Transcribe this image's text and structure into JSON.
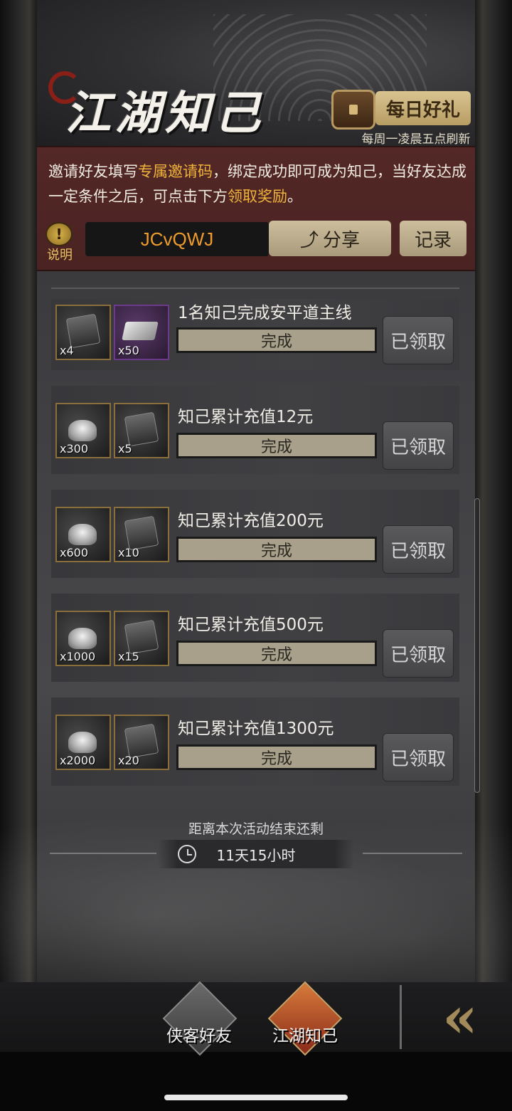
{
  "header": {
    "title": "江湖知己",
    "daily_gift_label": "每日好礼",
    "refresh_note": "每周一凌晨五点刷新"
  },
  "invite": {
    "text_part1": "邀请好友填写",
    "highlight1": "专属邀请码",
    "text_part2": "，绑定成功即可成为知己，当好友达成一定条件之后，可点击下方",
    "highlight2": "领取奖励",
    "text_part3": "。",
    "help_label": "说明",
    "invite_code": "JCvQWJ",
    "share_label": "分享",
    "record_label": "记录"
  },
  "tasks": [
    {
      "title": "1名知己完成安平道主线",
      "status": "完成",
      "button": "已领取",
      "rewards": [
        {
          "icon": "token-icon",
          "qty": "x4"
        },
        {
          "icon": "silver-bar-icon",
          "qty": "x50"
        }
      ]
    },
    {
      "title": "知己累计充值12元",
      "status": "完成",
      "button": "已领取",
      "rewards": [
        {
          "icon": "silver-ingot-icon",
          "qty": "x300"
        },
        {
          "icon": "token-icon",
          "qty": "x5"
        }
      ]
    },
    {
      "title": "知己累计充值200元",
      "status": "完成",
      "button": "已领取",
      "rewards": [
        {
          "icon": "silver-ingot-icon",
          "qty": "x600"
        },
        {
          "icon": "token-icon",
          "qty": "x10"
        }
      ]
    },
    {
      "title": "知己累计充值500元",
      "status": "完成",
      "button": "已领取",
      "rewards": [
        {
          "icon": "silver-ingot-icon",
          "qty": "x1000"
        },
        {
          "icon": "token-icon",
          "qty": "x15"
        }
      ]
    },
    {
      "title": "知己累计充值1300元",
      "status": "完成",
      "button": "已领取",
      "rewards": [
        {
          "icon": "silver-ingot-icon",
          "qty": "x2000"
        },
        {
          "icon": "token-icon",
          "qty": "x20"
        }
      ]
    }
  ],
  "countdown": {
    "label": "距离本次活动结束还剩",
    "time": "11天15小时"
  },
  "bottom_nav": {
    "friends_label": "侠客好友",
    "jianghu_label": "江湖知己",
    "collapse_symbol": "«"
  },
  "colors": {
    "highlight": "#f0b43c",
    "code": "#ef9b2c",
    "invite_bg": "#532826"
  }
}
